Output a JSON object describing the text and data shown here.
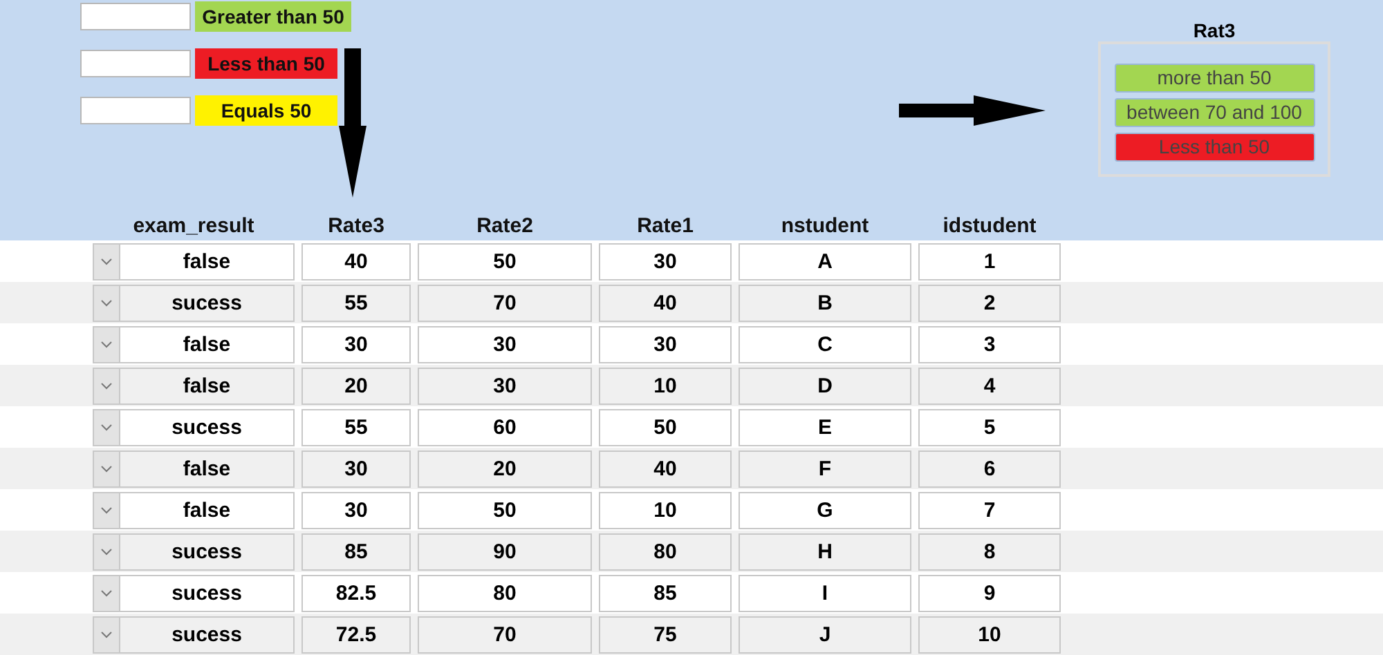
{
  "legend": [
    {
      "label": "Greater than 50",
      "color": "#a3d651"
    },
    {
      "label": "Less than 50",
      "color": "#ed1c24"
    },
    {
      "label": "Equals 50",
      "color": "#fff200"
    }
  ],
  "rating_box": {
    "title": "Rat3",
    "items": [
      {
        "label": "more than 50",
        "color": "#a3d651"
      },
      {
        "label": "between 70 and 100",
        "color": "#a3d651"
      },
      {
        "label": "Less than 50",
        "color": "#ed1c24"
      }
    ]
  },
  "table": {
    "columns": [
      "exam_result",
      "Rate3",
      "Rate2",
      "Rate1",
      "nstudent",
      "idstudent"
    ],
    "rows": [
      [
        "false",
        "40",
        "50",
        "30",
        "A",
        "1"
      ],
      [
        "sucess",
        "55",
        "70",
        "40",
        "B",
        "2"
      ],
      [
        "false",
        "30",
        "30",
        "30",
        "C",
        "3"
      ],
      [
        "false",
        "20",
        "30",
        "10",
        "D",
        "4"
      ],
      [
        "sucess",
        "55",
        "60",
        "50",
        "E",
        "5"
      ],
      [
        "false",
        "30",
        "20",
        "40",
        "F",
        "6"
      ],
      [
        "false",
        "30",
        "50",
        "10",
        "G",
        "7"
      ],
      [
        "sucess",
        "85",
        "90",
        "80",
        "H",
        "8"
      ],
      [
        "sucess",
        "82.5",
        "80",
        "85",
        "I",
        "9"
      ],
      [
        "sucess",
        "72.5",
        "70",
        "75",
        "J",
        "10"
      ]
    ]
  }
}
